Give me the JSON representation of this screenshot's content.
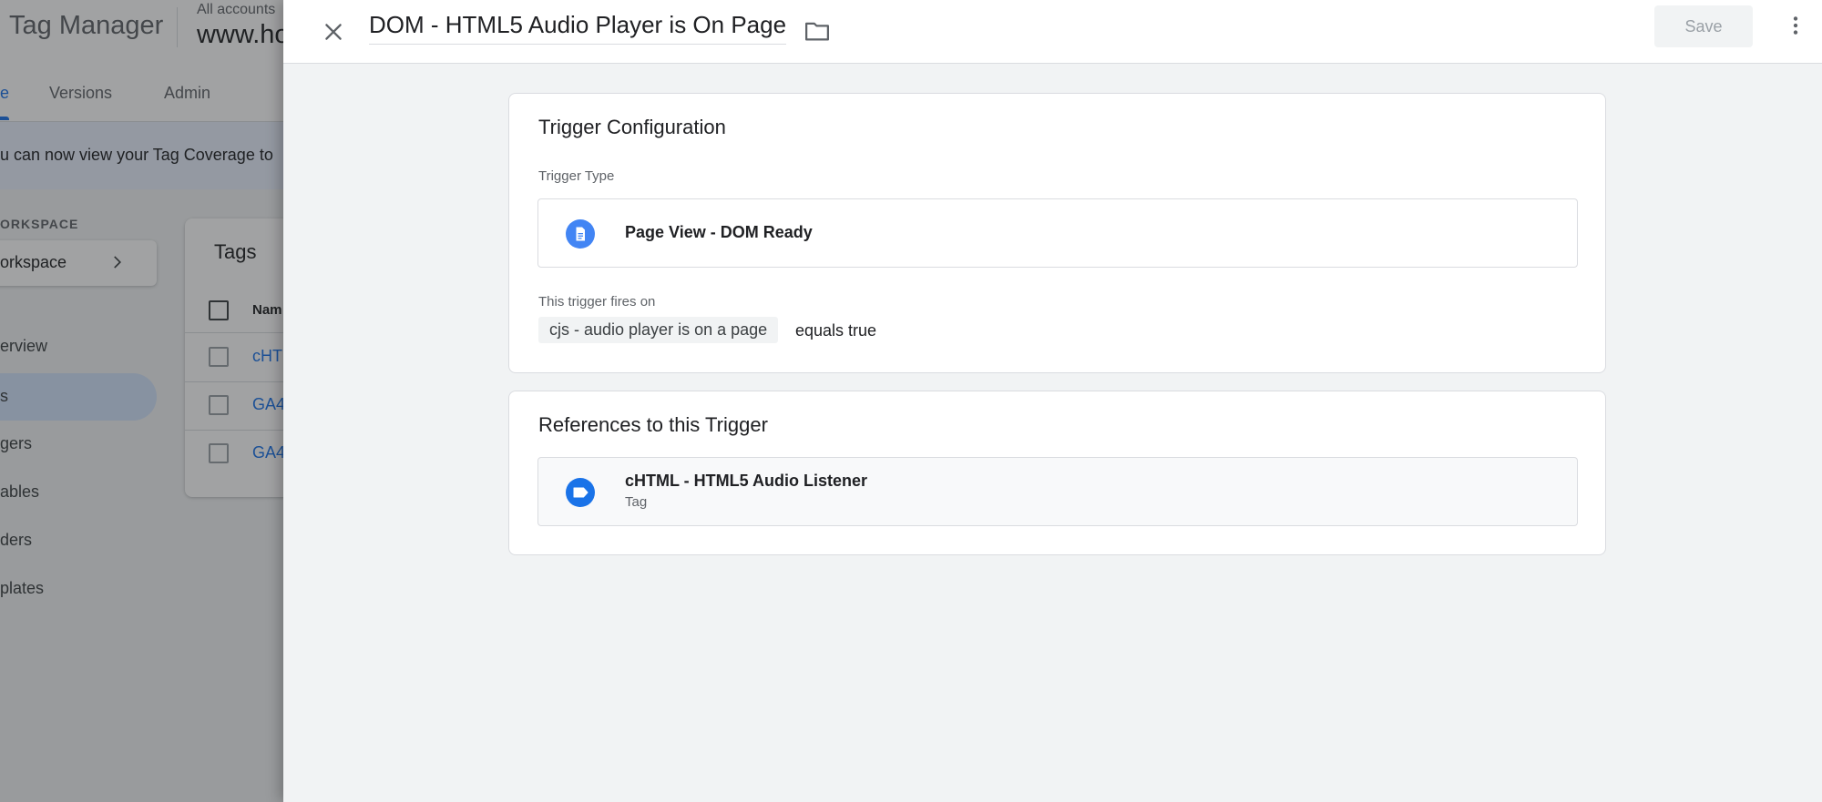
{
  "background": {
    "app_title": "Tag Manager",
    "accounts_label": "All accounts",
    "domain": "www.ho",
    "tabs": [
      {
        "label": "e"
      },
      {
        "label": "Versions"
      },
      {
        "label": "Admin"
      }
    ],
    "banner": "u can now view your Tag Coverage to",
    "workspace_label": "ORKSPACE",
    "workspace_name": "orkspace",
    "nav": [
      "erview",
      "s",
      "gers",
      "ables",
      "ders",
      "plates"
    ],
    "tags_card": {
      "title": "Tags",
      "header_name": "Nam",
      "rows": [
        "cHT",
        "GA4",
        "GA4"
      ]
    }
  },
  "drawer": {
    "title": "DOM - HTML5 Audio Player is On Page",
    "save_label": "Save",
    "config": {
      "title": "Trigger Configuration",
      "type_label": "Trigger Type",
      "type_name": "Page View - DOM Ready",
      "fires_label": "This trigger fires on",
      "condition_variable": "cjs - audio player is on a page",
      "condition_operator": "equals true"
    },
    "references": {
      "title": "References to this Trigger",
      "item_name": "cHTML - HTML5 Audio Listener",
      "item_type": "Tag"
    }
  },
  "colors": {
    "accent": "#1a73e8",
    "trigger_icon": "#4285f4",
    "tag_icon": "#1a73e8"
  },
  "icons": {
    "close": "close-icon",
    "folder": "folder-icon",
    "more": "more-vert-icon",
    "trigger_type": "document-icon",
    "reference": "tag-icon"
  }
}
